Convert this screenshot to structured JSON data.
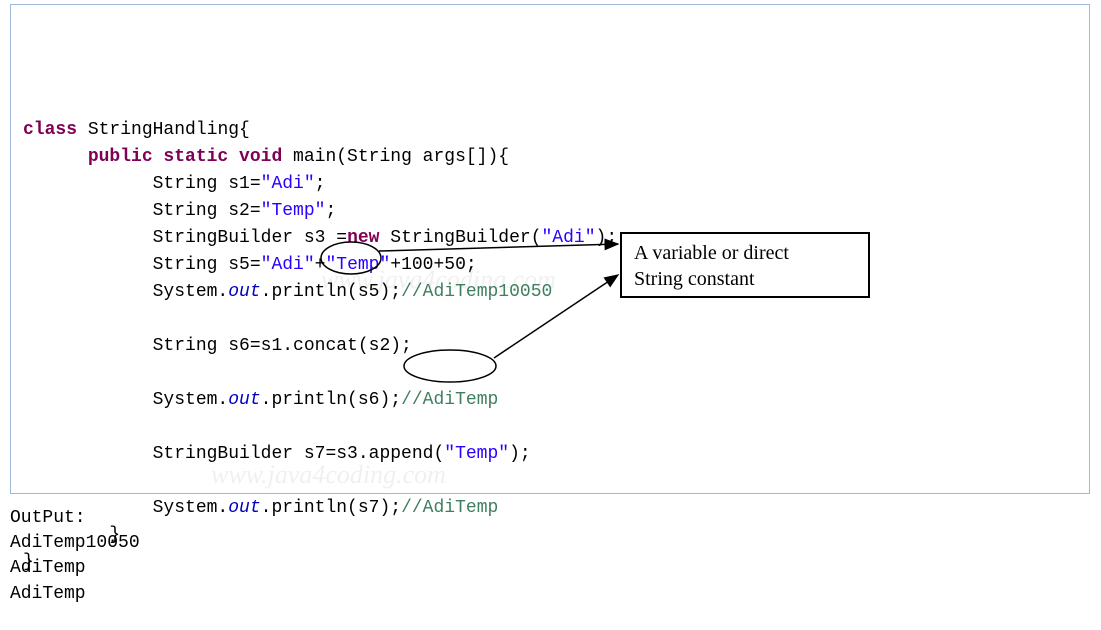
{
  "watermark": "www.java4coding.com",
  "code": {
    "l1": {
      "kw": "class",
      "rest": " StringHandling{"
    },
    "l2": {
      "kw": "public static void",
      "rest": " main(String args[]){"
    },
    "l3a": "            String s1=",
    "l3b": "\"Adi\"",
    "l3c": ";",
    "l4a": "            String s2=",
    "l4b": "\"Temp\"",
    "l4c": ";",
    "l5a": "            StringBuilder s3 =",
    "l5b": "new",
    "l5c": " StringBuilder(",
    "l5d": "\"Adi\"",
    "l5e": ");",
    "l6a": "            String s5=",
    "l6b": "\"Adi\"",
    "l6c": "+",
    "l6d": "\"Temp\"",
    "l6e": "+100+50;",
    "l7a": "            System.",
    "l7b": "out",
    "l7c": ".println(s5);",
    "l7d": "//AdiTemp10050",
    "l8": "",
    "l9": "            String s6=s1.concat(s2);",
    "l10": "",
    "l11a": "            System.",
    "l11b": "out",
    "l11c": ".println(s6);",
    "l11d": "//AdiTemp",
    "l12": "",
    "l13a": "            StringBuilder s7=s3.append(",
    "l13b": "\"Temp\"",
    "l13c": ");",
    "l14": "",
    "l15a": "            System.",
    "l15b": "out",
    "l15c": ".println(s7);",
    "l15d": "//AdiTemp",
    "l16": "        }",
    "l17": "}"
  },
  "annotation": {
    "line1": "A variable or direct",
    "line2": "String constant"
  },
  "output": {
    "header": "OutPut:",
    "line1": "AdiTemp10050",
    "line2": "AdiTemp",
    "line3": "AdiTemp"
  }
}
